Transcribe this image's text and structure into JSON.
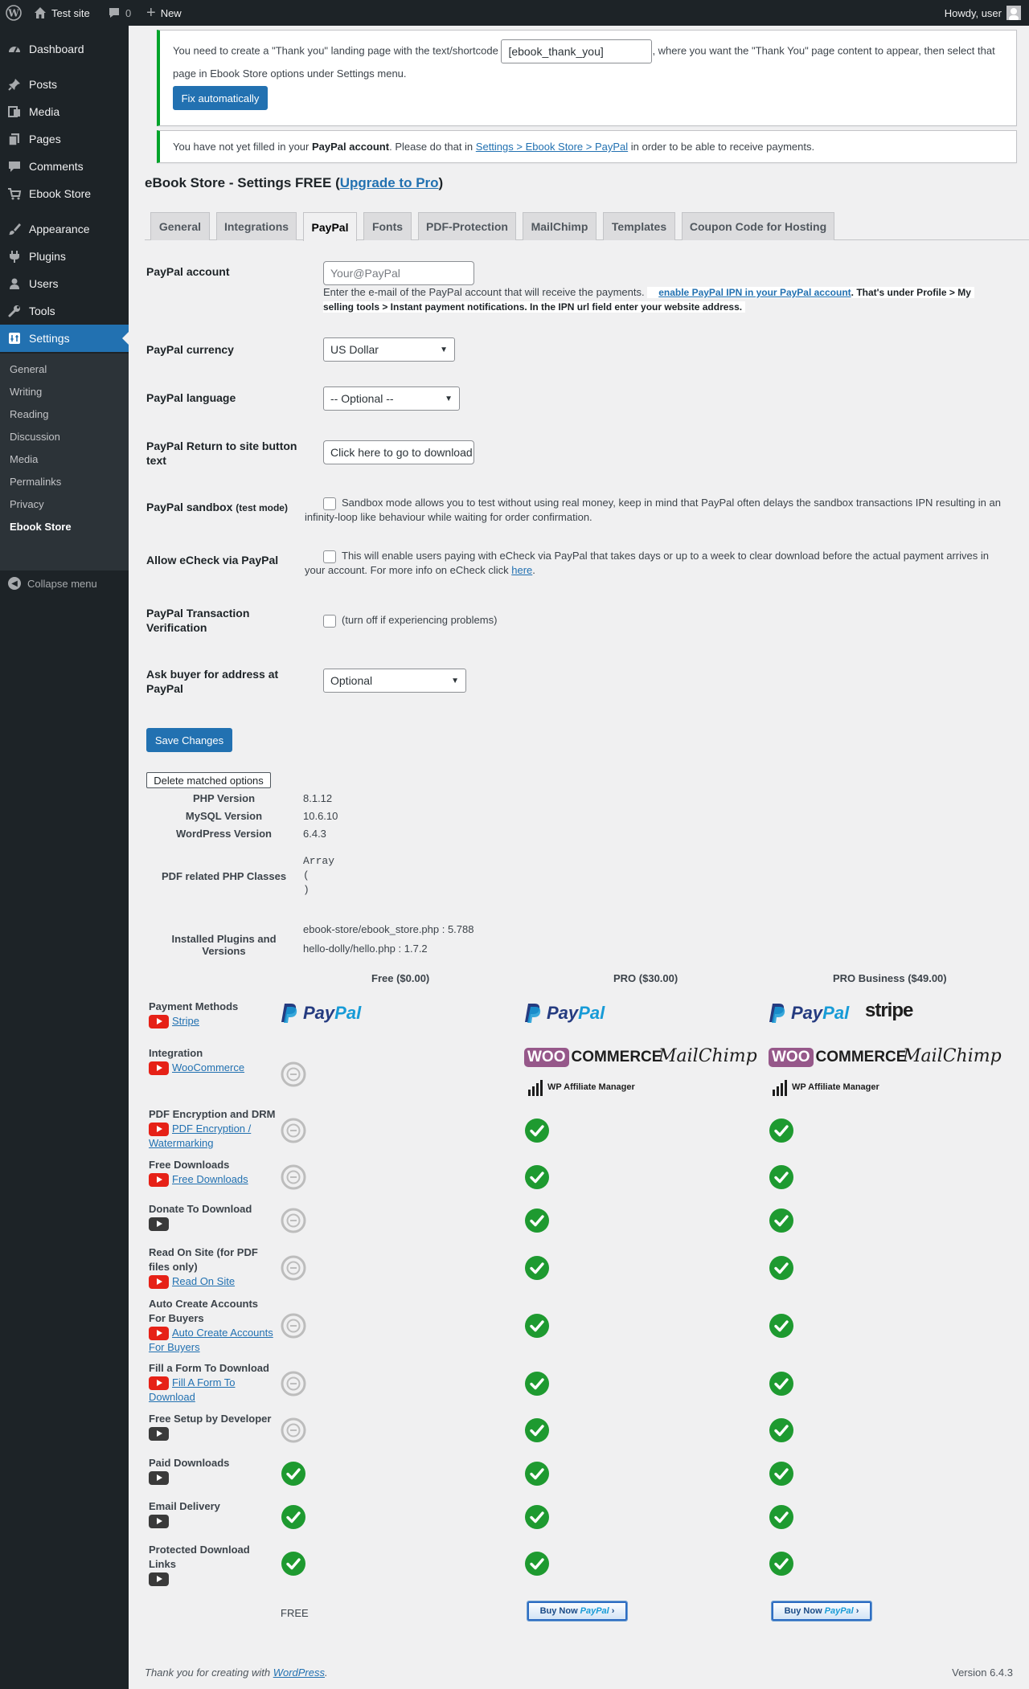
{
  "admin_bar": {
    "site_name": "Test site",
    "comments_count": "0",
    "new_label": "New",
    "howdy": "Howdy, user"
  },
  "sidebar": {
    "items": [
      {
        "label": "Dashboard",
        "icon": "dashboard-icon"
      },
      {
        "label": "Posts",
        "icon": "pin-icon"
      },
      {
        "label": "Media",
        "icon": "media-icon"
      },
      {
        "label": "Pages",
        "icon": "pages-icon"
      },
      {
        "label": "Comments",
        "icon": "comments-icon"
      },
      {
        "label": "Ebook Store",
        "icon": "cart-icon"
      },
      {
        "label": "Appearance",
        "icon": "brush-icon"
      },
      {
        "label": "Plugins",
        "icon": "plugin-icon"
      },
      {
        "label": "Users",
        "icon": "users-icon"
      },
      {
        "label": "Tools",
        "icon": "wrench-icon"
      },
      {
        "label": "Settings",
        "icon": "settings-icon"
      }
    ],
    "submenu": [
      "General",
      "Writing",
      "Reading",
      "Discussion",
      "Media",
      "Permalinks",
      "Privacy",
      "Ebook Store"
    ],
    "collapse_label": "Collapse menu"
  },
  "notices": {
    "thankyou_before": "You need to create a \"Thank you\" landing page with the text/shortcode",
    "thankyou_shortcode": "[ebook_thank_you]",
    "thankyou_after1": ", where you want the \"Thank You\" page content to appear, then select that",
    "thankyou_after2": "page in Ebook Store options under Settings menu.",
    "fix_button": "Fix automatically",
    "paypal_before": "You have not yet filled in your",
    "paypal_bold": "PayPal account",
    "paypal_mid": ". Please do that in",
    "paypal_link": "Settings > Ebook Store > PayPal",
    "paypal_after": "in order to be able to receive payments."
  },
  "page": {
    "title_prefix": "eBook Store - Settings FREE (",
    "title_link": "Upgrade to Pro",
    "title_suffix": ")"
  },
  "tabs": [
    "General",
    "Integrations",
    "PayPal",
    "Fonts",
    "PDF-Protection",
    "MailChimp",
    "Templates",
    "Coupon Code for Hosting"
  ],
  "form": {
    "paypal_account_label": "PayPal account",
    "paypal_account_placeholder": "Your@PayPal",
    "paypal_account_desc": "Enter the e-mail of the PayPal account that will receive the payments.",
    "ipn_link": "enable PayPal IPN in your PayPal account",
    "ipn_text1": ". That's under Profile > My",
    "ipn_text2": "selling tools > Instant payment notifications. In the IPN url field enter your website address.",
    "currency_label": "PayPal currency",
    "currency_value": "US Dollar",
    "language_label": "PayPal language",
    "language_value": "-- Optional --",
    "return_label_1": "PayPal Return to site button",
    "return_label_2": "text",
    "return_value": "Click here to go to download page",
    "sandbox_label": "PayPal sandbox",
    "sandbox_label_small": "(test mode)",
    "sandbox_desc_1": "Sandbox mode allows you to test without using real money, keep in mind that PayPal often delays the sandbox transactions IPN resulting in an",
    "sandbox_desc_2": "infinity-loop like behaviour while waiting for order confirmation.",
    "echeck_label": "Allow eCheck via PayPal",
    "echeck_desc_1": "This will enable users paying with eCheck via PayPal that takes days or up to a week to clear download before the actual payment arrives in",
    "echeck_desc_2": "your account. For more info on eCheck click",
    "echeck_link": "here",
    "verify_label_1": "PayPal Transaction",
    "verify_label_2": "Verification",
    "verify_desc": "(turn off if experiencing problems)",
    "address_label_1": "Ask buyer for address at",
    "address_label_2": "PayPal",
    "address_value": "Optional",
    "save_button": "Save Changes"
  },
  "system": {
    "delete_button": "Delete matched options",
    "php_label": "PHP Version",
    "php_value": "8.1.12",
    "mysql_label": "MySQL Version",
    "mysql_value": "10.6.10",
    "wp_label": "WordPress Version",
    "wp_value": "6.4.3",
    "pdf_label": "PDF related PHP Classes",
    "pdf_value_1": "Array",
    "pdf_value_2": "(",
    "pdf_value_3": ")",
    "plugins_label": "Installed Plugins and Versions",
    "plugin_1": "ebook-store/ebook_store.php : 5.788",
    "plugin_2": "hello-dolly/hello.php : 1.7.2"
  },
  "comparison": {
    "headers": [
      "Free ($0.00)",
      "PRO ($30.00)",
      "PRO Business ($49.00)"
    ],
    "brands": {
      "paypal_a": "Pay",
      "paypal_b": "Pal",
      "stripe": "stripe",
      "woo": "WOO",
      "commerce": "COMMERCE",
      "mailchimp": "MailChimp",
      "wpam": "WP Affiliate Manager"
    },
    "rows": [
      {
        "title": "Payment Methods",
        "link": "Stripe",
        "video": "red",
        "free": "paypal",
        "pro": "paypal",
        "biz": "paypal-stripe"
      },
      {
        "title": "Integration",
        "link": "WooCommerce",
        "video": "red",
        "free": "no",
        "pro": "integrations",
        "biz": "integrations"
      },
      {
        "title": "PDF Encryption and DRM",
        "link": "PDF Encryption / Watermarking",
        "video": "red",
        "free": "no",
        "pro": "yes",
        "biz": "yes"
      },
      {
        "title": "Free Downloads",
        "link": "Free Downloads",
        "video": "red",
        "free": "no",
        "pro": "yes",
        "biz": "yes"
      },
      {
        "title": "Donate To Download",
        "link": "",
        "video": "dark",
        "free": "no",
        "pro": "yes",
        "biz": "yes"
      },
      {
        "title": "Read On Site (for PDF files only)",
        "link": "Read On Site",
        "video": "red",
        "free": "no",
        "pro": "yes",
        "biz": "yes"
      },
      {
        "title": "Auto Create Accounts For Buyers",
        "link": "Auto Create Accounts For Buyers",
        "video": "red",
        "free": "no",
        "pro": "yes",
        "biz": "yes"
      },
      {
        "title": "Fill a Form To Download",
        "link": "Fill A Form To Download",
        "video": "red",
        "free": "no",
        "pro": "yes",
        "biz": "yes"
      },
      {
        "title": "Free Setup by Developer",
        "link": "",
        "video": "dark",
        "free": "no",
        "pro": "yes",
        "biz": "yes"
      },
      {
        "title": "Paid Downloads",
        "link": "",
        "video": "dark",
        "free": "yes",
        "pro": "yes",
        "biz": "yes"
      },
      {
        "title": "Email Delivery",
        "link": "",
        "video": "dark",
        "free": "yes",
        "pro": "yes",
        "biz": "yes"
      },
      {
        "title": "Protected Download Links",
        "link": "",
        "video": "dark",
        "free": "yes",
        "pro": "yes",
        "biz": "yes"
      }
    ],
    "free_label": "FREE",
    "buy_now_label": "Buy Now",
    "buy_now_brand": "PayPal"
  },
  "footer": {
    "thanks_prefix": "Thank you for creating with",
    "thanks_link": "WordPress",
    "thanks_suffix": ".",
    "version": "Version 6.4.3"
  },
  "colors": {
    "accent": "#2271b1",
    "success": "#00a32a",
    "check": "#1e9a30",
    "disabled": "#bdbdbd"
  }
}
